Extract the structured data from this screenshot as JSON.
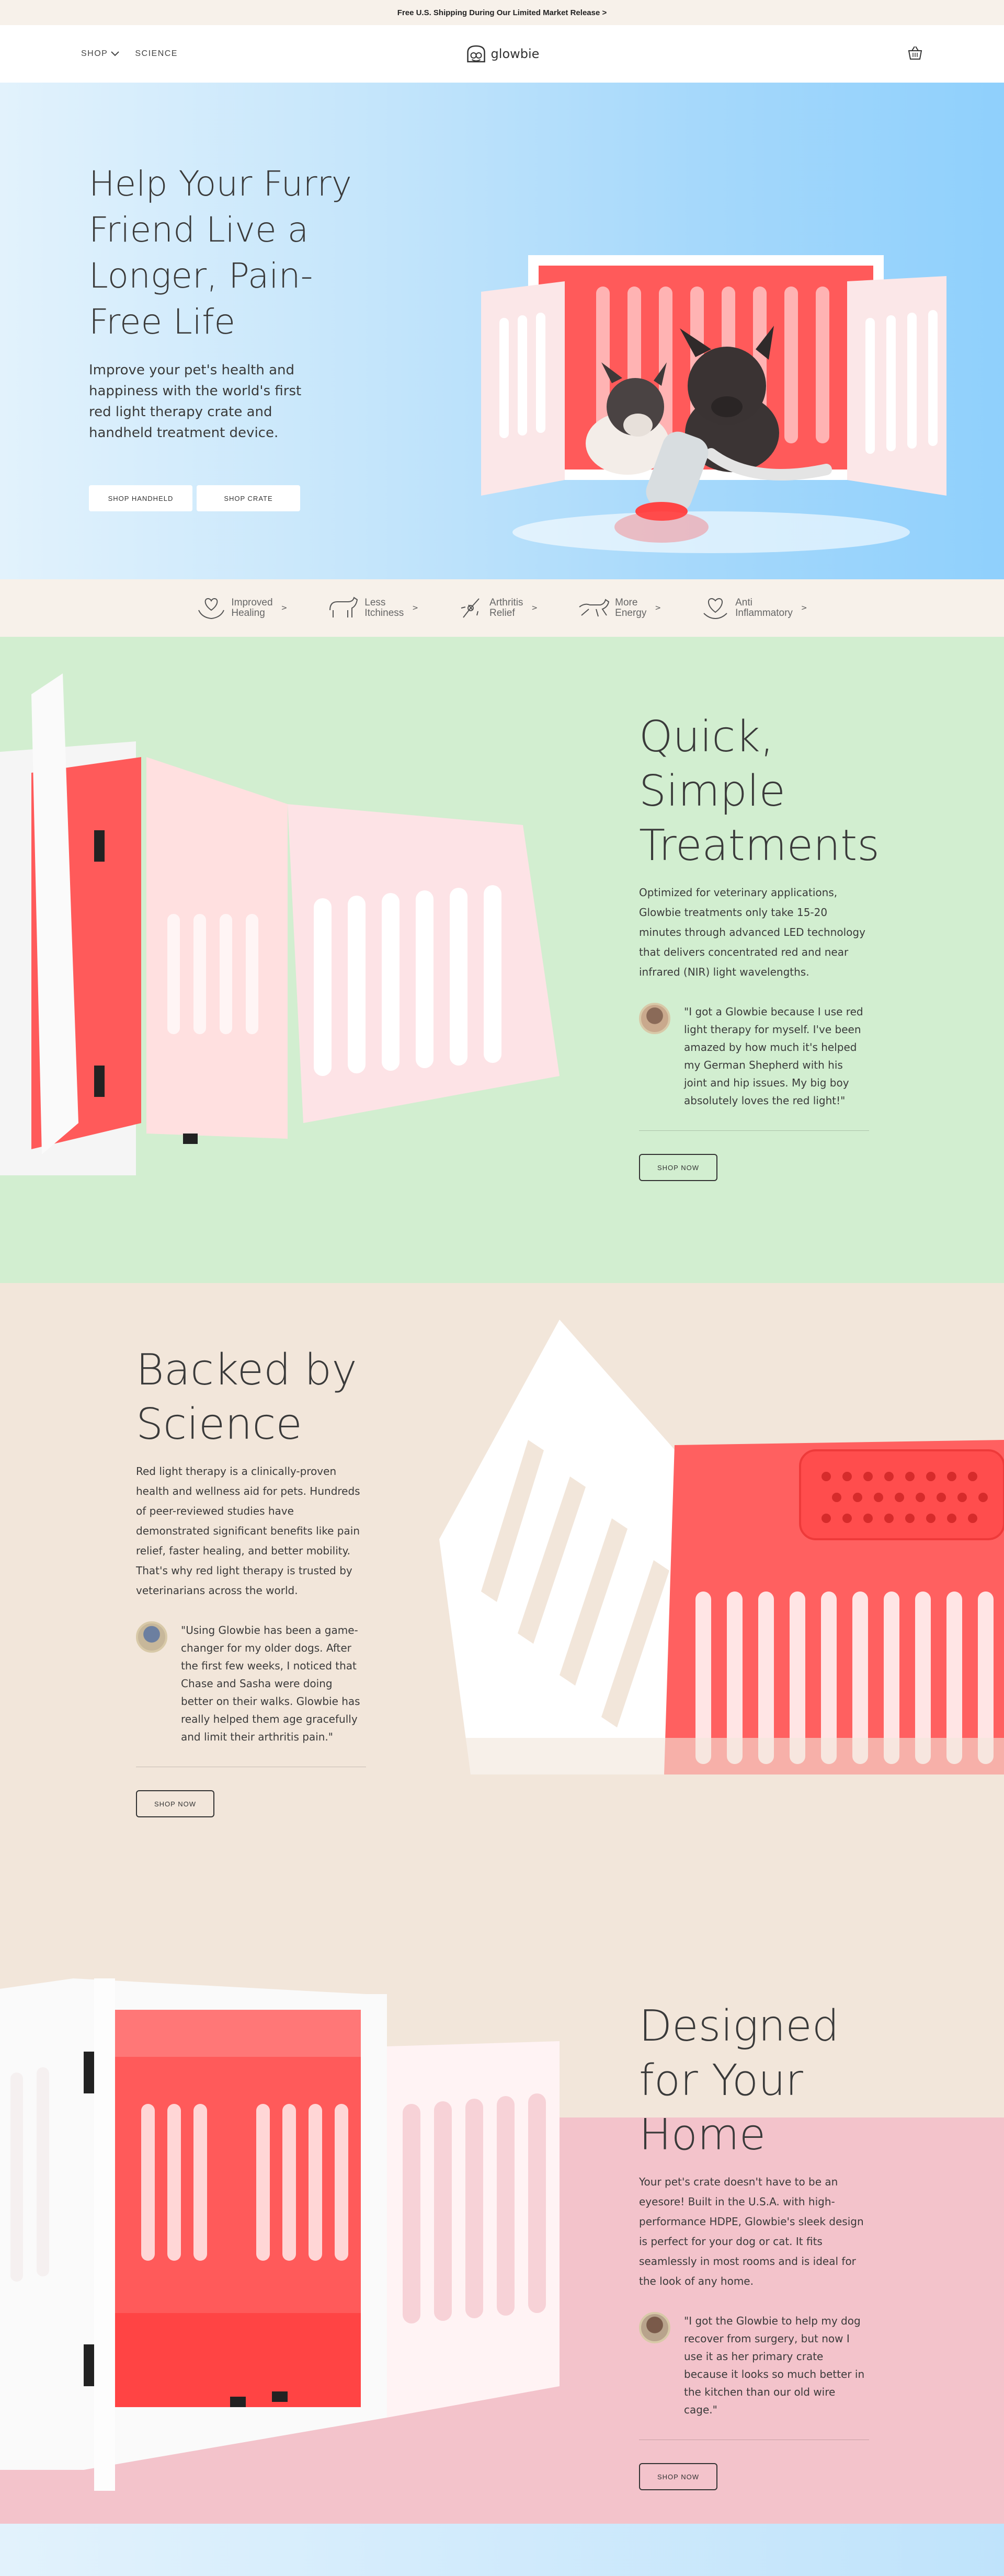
{
  "announcement": {
    "text": "Free U.S. Shipping During Our Limited Market Release >"
  },
  "header": {
    "nav": [
      {
        "label": "SHOP"
      },
      {
        "label": "SCIENCE"
      }
    ],
    "logo_text": "glowbie"
  },
  "hero": {
    "title": "Help Your Furry Friend Live a Longer, Pain-Free Life",
    "subtitle": "Improve your pet's health and happiness with the world's first red light therapy crate and handheld treatment device.",
    "btn_handheld": "SHOP HANDHELD",
    "btn_crate": "SHOP CRATE"
  },
  "benefits": [
    {
      "line1": "Improved",
      "line2": "Healing",
      "icon": "heart-hands-icon"
    },
    {
      "line1": "Less",
      "line2": "Itchiness",
      "icon": "dog-scratching-icon"
    },
    {
      "line1": "Arthritis",
      "line2": "Relief",
      "icon": "joint-icon"
    },
    {
      "line1": "More",
      "line2": "Energy",
      "icon": "running-dog-icon"
    },
    {
      "line1": "Anti",
      "line2": "Inflammatory",
      "icon": "heart-care-icon"
    }
  ],
  "quick": {
    "title": "Quick, Simple Treatments",
    "body": "Optimized for veterinary applications, Glowbie treatments only take 15-20 minutes through advanced LED technology that delivers concentrated red and near infrared (NIR) light wavelengths.",
    "quote": "\"I got a Glowbie because I use red light therapy for myself. I've been amazed by how much it's helped my German Shepherd with his joint and hip issues. My big boy absolutely loves the red light!\"",
    "button": "SHOP NOW"
  },
  "science": {
    "title": "Backed by Science",
    "body": "Red light therapy is a clinically-proven health and wellness aid for pets. Hundreds of peer-reviewed studies have demonstrated significant benefits like pain relief, faster healing, and better mobility. That's why red light therapy is trusted by veterinarians across the world.",
    "quote": "\"Using Glowbie has been a game-changer for my older dogs. After the first few weeks, I noticed that Chase and Sasha were doing better on their walks. Glowbie has really helped them age gracefully and limit their arthritis pain.\"",
    "button": "SHOP NOW"
  },
  "home": {
    "title": "Designed for Your Home",
    "body": "Your pet's crate doesn't have to be an eyesore! Built in the U.S.A. with high-performance HDPE, Glowbie's sleek design is perfect for your dog or cat. It fits seamlessly in most rooms and is ideal for the look of any home.",
    "quote": "\"I got the Glowbie to help my dog recover from surgery, but now I use it as her primary crate because it looks so much better in the kitchen than our old wire cage.\"",
    "button": "SHOP NOW"
  },
  "colors": {
    "accent_red": "#ff5a5a",
    "hero_blue": "#8fd0fc",
    "green_bg": "#d2eed0",
    "beige_bg": "#f2e6da",
    "pink_bg": "#f3c3cb"
  }
}
